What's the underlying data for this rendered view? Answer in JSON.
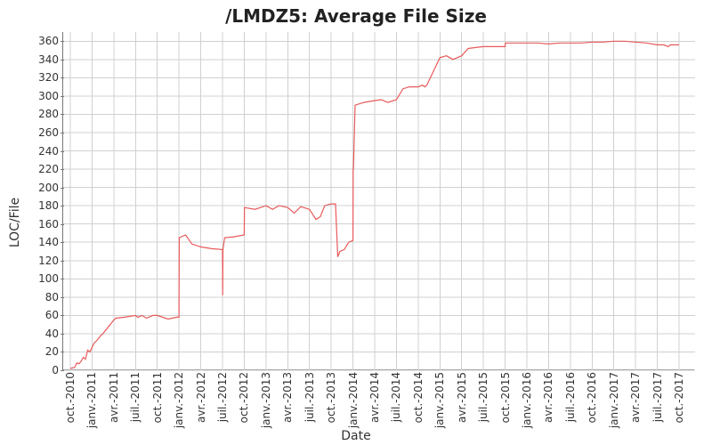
{
  "chart_data": {
    "type": "line",
    "title": "/LMDZ5: Average File Size",
    "xlabel": "Date",
    "ylabel": "LOC/File",
    "ylim": [
      0,
      370
    ],
    "y_ticks": [
      0,
      20,
      40,
      60,
      80,
      100,
      120,
      140,
      160,
      180,
      200,
      220,
      240,
      260,
      280,
      300,
      320,
      340,
      360
    ],
    "x_categories": [
      "oct.-2010",
      "janv.-2011",
      "avr.-2011",
      "juil.-2011",
      "oct.-2011",
      "janv.-2012",
      "avr.-2012",
      "juil.-2012",
      "oct.-2012",
      "janv.-2013",
      "avr.-2013",
      "juil.-2013",
      "oct.-2013",
      "janv.-2014",
      "avr.-2014",
      "juil.-2014",
      "oct.-2014",
      "janv.-2015",
      "avr.-2015",
      "juil.-2015",
      "oct.-2015",
      "janv.-2016",
      "avr.-2016",
      "juil.-2016",
      "oct.-2016",
      "janv.-2017",
      "avr.-2017",
      "juil.-2017",
      "oct.-2017"
    ],
    "series": [
      {
        "name": "Average File Size",
        "color": "#e85a5a",
        "points": [
          [
            0.0,
            2
          ],
          [
            0.2,
            3
          ],
          [
            0.3,
            8
          ],
          [
            0.4,
            7
          ],
          [
            0.5,
            10
          ],
          [
            0.6,
            14
          ],
          [
            0.7,
            12
          ],
          [
            0.8,
            22
          ],
          [
            0.9,
            20
          ],
          [
            1.0,
            25
          ],
          [
            1.1,
            30
          ],
          [
            1.2,
            32
          ],
          [
            1.3,
            35
          ],
          [
            1.4,
            38
          ],
          [
            1.5,
            40
          ],
          [
            2.0,
            55
          ],
          [
            2.1,
            57
          ],
          [
            2.5,
            58
          ],
          [
            3.0,
            60
          ],
          [
            3.1,
            58
          ],
          [
            3.3,
            60
          ],
          [
            3.5,
            57
          ],
          [
            3.8,
            60
          ],
          [
            4.0,
            60
          ],
          [
            4.5,
            56
          ],
          [
            4.9,
            58
          ],
          [
            5.0,
            58
          ],
          [
            5.01,
            145
          ],
          [
            5.3,
            148
          ],
          [
            5.6,
            138
          ],
          [
            6.0,
            135
          ],
          [
            6.5,
            133
          ],
          [
            7.0,
            132
          ],
          [
            7.01,
            82
          ],
          [
            7.02,
            132
          ],
          [
            7.1,
            145
          ],
          [
            7.5,
            146
          ],
          [
            8.0,
            148
          ],
          [
            8.01,
            178
          ],
          [
            8.5,
            176
          ],
          [
            9.0,
            180
          ],
          [
            9.3,
            176
          ],
          [
            9.6,
            180
          ],
          [
            10.0,
            178
          ],
          [
            10.3,
            172
          ],
          [
            10.6,
            179
          ],
          [
            11.0,
            176
          ],
          [
            11.3,
            165
          ],
          [
            11.5,
            168
          ],
          [
            11.7,
            180
          ],
          [
            12.0,
            182
          ],
          [
            12.2,
            182
          ],
          [
            12.3,
            124
          ],
          [
            12.4,
            130
          ],
          [
            12.6,
            132
          ],
          [
            12.8,
            140
          ],
          [
            13.0,
            142
          ],
          [
            13.01,
            220
          ],
          [
            13.02,
            220
          ],
          [
            13.1,
            290
          ],
          [
            13.5,
            293
          ],
          [
            14.0,
            295
          ],
          [
            14.3,
            296
          ],
          [
            14.6,
            293
          ],
          [
            15.0,
            296
          ],
          [
            15.3,
            308
          ],
          [
            15.6,
            310
          ],
          [
            16.0,
            310
          ],
          [
            16.2,
            312
          ],
          [
            16.3,
            310
          ],
          [
            16.4,
            312
          ],
          [
            17.0,
            342
          ],
          [
            17.3,
            344
          ],
          [
            17.6,
            340
          ],
          [
            18.0,
            344
          ],
          [
            18.3,
            352
          ],
          [
            18.6,
            353
          ],
          [
            19.0,
            354
          ],
          [
            19.5,
            354
          ],
          [
            20.0,
            354
          ],
          [
            20.01,
            358
          ],
          [
            20.5,
            358
          ],
          [
            21.0,
            358
          ],
          [
            21.5,
            358
          ],
          [
            22.0,
            357
          ],
          [
            22.5,
            358
          ],
          [
            23.0,
            358
          ],
          [
            23.5,
            358
          ],
          [
            24.0,
            359
          ],
          [
            24.5,
            359
          ],
          [
            25.0,
            360
          ],
          [
            25.5,
            360
          ],
          [
            26.0,
            359
          ],
          [
            26.5,
            358
          ],
          [
            27.0,
            356
          ],
          [
            27.3,
            356
          ],
          [
            27.5,
            354
          ],
          [
            27.6,
            356
          ],
          [
            28.0,
            356
          ]
        ]
      }
    ]
  }
}
